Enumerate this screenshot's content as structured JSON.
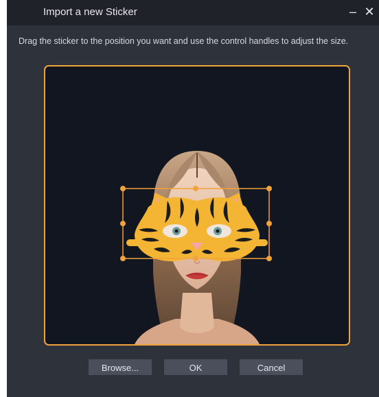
{
  "dialog": {
    "title": "Import a new Sticker",
    "minimize_glyph": "–",
    "close_glyph": "✕",
    "instruction": "Drag the sticker to the position you want and use the control handles to adjust the size."
  },
  "preview": {
    "accent_color": "#f2a23a",
    "sticker": "tiger-mask",
    "background_color": "#111620"
  },
  "buttons": {
    "browse": "Browse...",
    "ok": "OK",
    "cancel": "Cancel"
  }
}
